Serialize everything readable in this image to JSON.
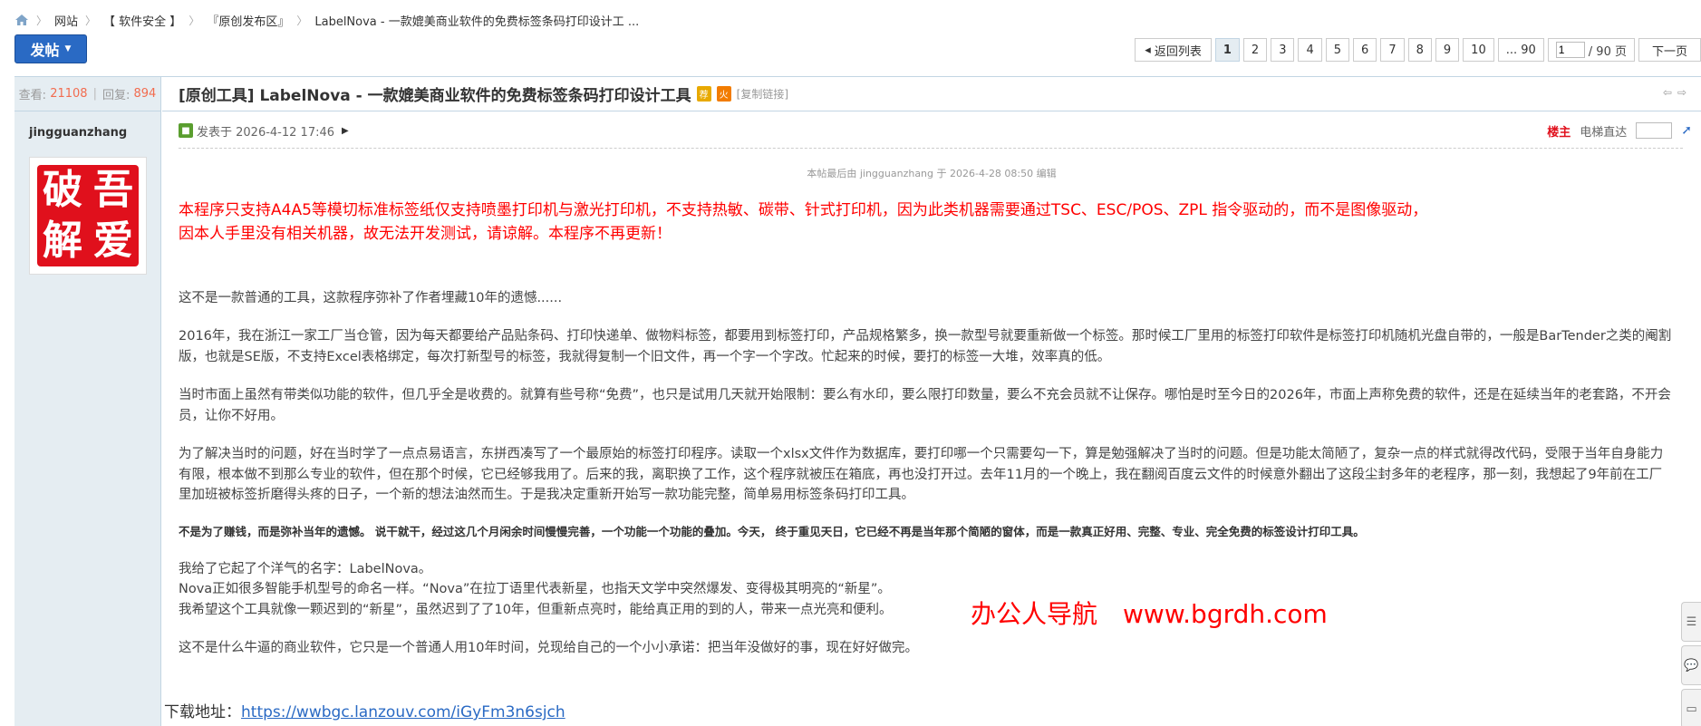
{
  "breadcrumb": {
    "items": [
      "网站",
      "【 软件安全 】",
      "『原创发布区』",
      "LabelNova - 一款媲美商业软件的免费标签条码打印设计工 ..."
    ]
  },
  "toolbar": {
    "post_label": "发帖"
  },
  "pager": {
    "back_label": "返回列表",
    "pages": [
      "1",
      "2",
      "3",
      "4",
      "5",
      "6",
      "7",
      "8",
      "9",
      "10"
    ],
    "current": "1",
    "last_label": "... 90",
    "jump_value": "1",
    "jump_total": "/ 90 页",
    "next_label": "下一页"
  },
  "sidebar": {
    "views_label": "查看:",
    "views": "21108",
    "replies_label": "回复:",
    "replies": "894",
    "author": "jingguanzhang",
    "avatar_chars": [
      "破",
      "吾",
      "解",
      "爱"
    ]
  },
  "thread": {
    "title": "[原创工具] LabelNova - 一款媲美商业软件的免费标签条码打印设计工具",
    "copy_link": "[复制链接]"
  },
  "post_meta": {
    "posted": "发表于 2026-4-12 17:46",
    "op_badge": "楼主",
    "elevator_label": "电梯直达",
    "edited_note": "本帖最后由 jingguanzhang 于 2026-4-28 08:50 编辑"
  },
  "body": {
    "red_1": "本程序只支持A4A5等模切标准标签纸仅支持喷墨打印机与激光打印机，不支持热敏、碳带、针式打印机，因为此类机器需要通过TSC、ESC/POS、ZPL 指令驱动的，而不是图像驱动，",
    "red_2": "因本人手里没有相关机器，故无法开发测试，请谅解。本程序不再更新！",
    "p1": "这不是一款普通的工具，这款程序弥补了作者埋藏10年的遗憾......",
    "p2": "2016年，我在浙江一家工厂当仓管，因为每天都要给产品贴条码、打印快递单、做物料标签，都要用到标签打印，产品规格繁多，换一款型号就要重新做一个标签。那时候工厂里用的标签打印软件是标签打印机随机光盘自带的，一般是BarTender之类的阉割版，也就是SE版，不支持Excel表格绑定，每次打新型号的标签，我就得复制一个旧文件，再一个字一个字改。忙起来的时候，要打的标签一大堆，效率真的低。",
    "p3": "当时市面上虽然有带类似功能的软件，但几乎全是收费的。就算有些号称“免费”，也只是试用几天就开始限制：要么有水印，要么限打印数量，要么不充会员就不让保存。哪怕是时至今日的2026年，市面上声称免费的软件，还是在延续当年的老套路，不开会员，让你不好用。",
    "p4": "为了解决当时的问题，好在当时学了一点点易语言，东拼西凑写了一个最原始的标签打印程序。读取一个xlsx文件作为数据库，要打印哪一个只需要勾一下，算是勉强解决了当时的问题。但是功能太简陋了，复杂一点的样式就得改代码，受限于当年自身能力有限，根本做不到那么专业的软件，但在那个时候，它已经够我用了。后来的我，离职换了工作，这个程序就被压在箱底，再也没打开过。去年11月的一个晚上，我在翻阅百度云文件的时候意外翻出了这段尘封多年的老程序，那一刻，我想起了9年前在工厂里加班被标签折磨得头疼的日子，一个新的想法油然而生。于是我决定重新开始写一款功能完整，简单易用标签条码打印工具。",
    "p5": "不是为了赚钱，而是弥补当年的遗憾。 说干就干，经过这几个月闲余时间慢慢完善，一个功能一个功能的叠加。今天， 终于重见天日，它已经不再是当年那个简陋的窗体，而是一款真正好用、完整、专业、完全免费的标签设计打印工具。",
    "p6a": "我给了它起了个洋气的名字：LabelNova。",
    "p6b": "Nova正如很多智能手机型号的命名一样。“Nova”在拉丁语里代表新星，也指天文学中突然爆发、变得极其明亮的“新星”。",
    "p6c": "我希望这个工具就像一颗迟到的“新星”，虽然迟到了了10年，但重新点亮时，能给真正用的到的人，带来一点光亮和便利。",
    "p7": "这不是什么牛逼的商业软件，它只是一个普通人用10年时间，兑现给自己的一个小小承诺：把当年没做好的事，现在好好做完。",
    "download_label": "下载地址：",
    "download_url": "https://wwbgc.lanzouv.com/iGyFm3n6sjch"
  },
  "watermark": {
    "name": "办公人导航",
    "site": "www.bgrdh.com"
  },
  "colors": {
    "accent": "#2a6ac4",
    "sidebar_bg": "#e5edf2",
    "notice_red": "#ff0000",
    "count_orange": "#f26c4f"
  }
}
